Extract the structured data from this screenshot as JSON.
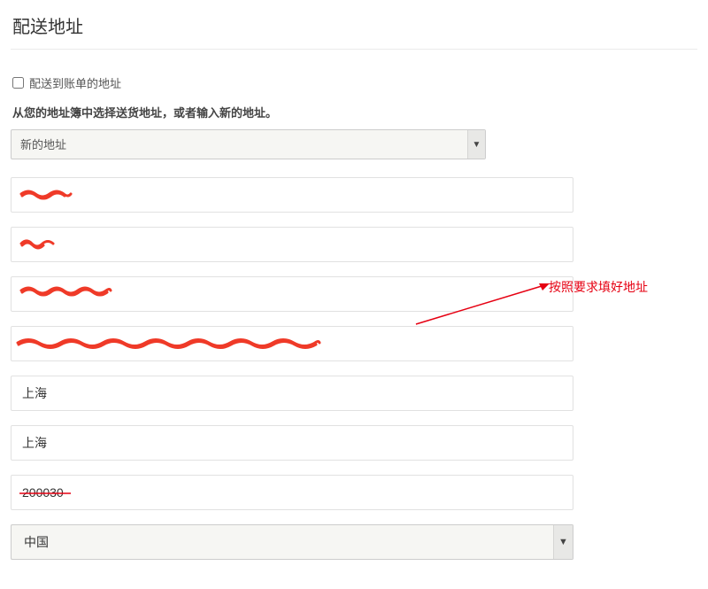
{
  "title": "配送地址",
  "checkbox_label": "配送到账单的地址",
  "help_text": "从您的地址簿中选择送货地址，或者输入新的地址。",
  "address_select": {
    "selected": "新的地址"
  },
  "fields": {
    "first_name": "",
    "last_name": "",
    "company": "",
    "street": "",
    "city": "上海",
    "state": "上海",
    "postal_code": "200030",
    "country": "中国"
  },
  "annotation": "按照要求填好地址"
}
